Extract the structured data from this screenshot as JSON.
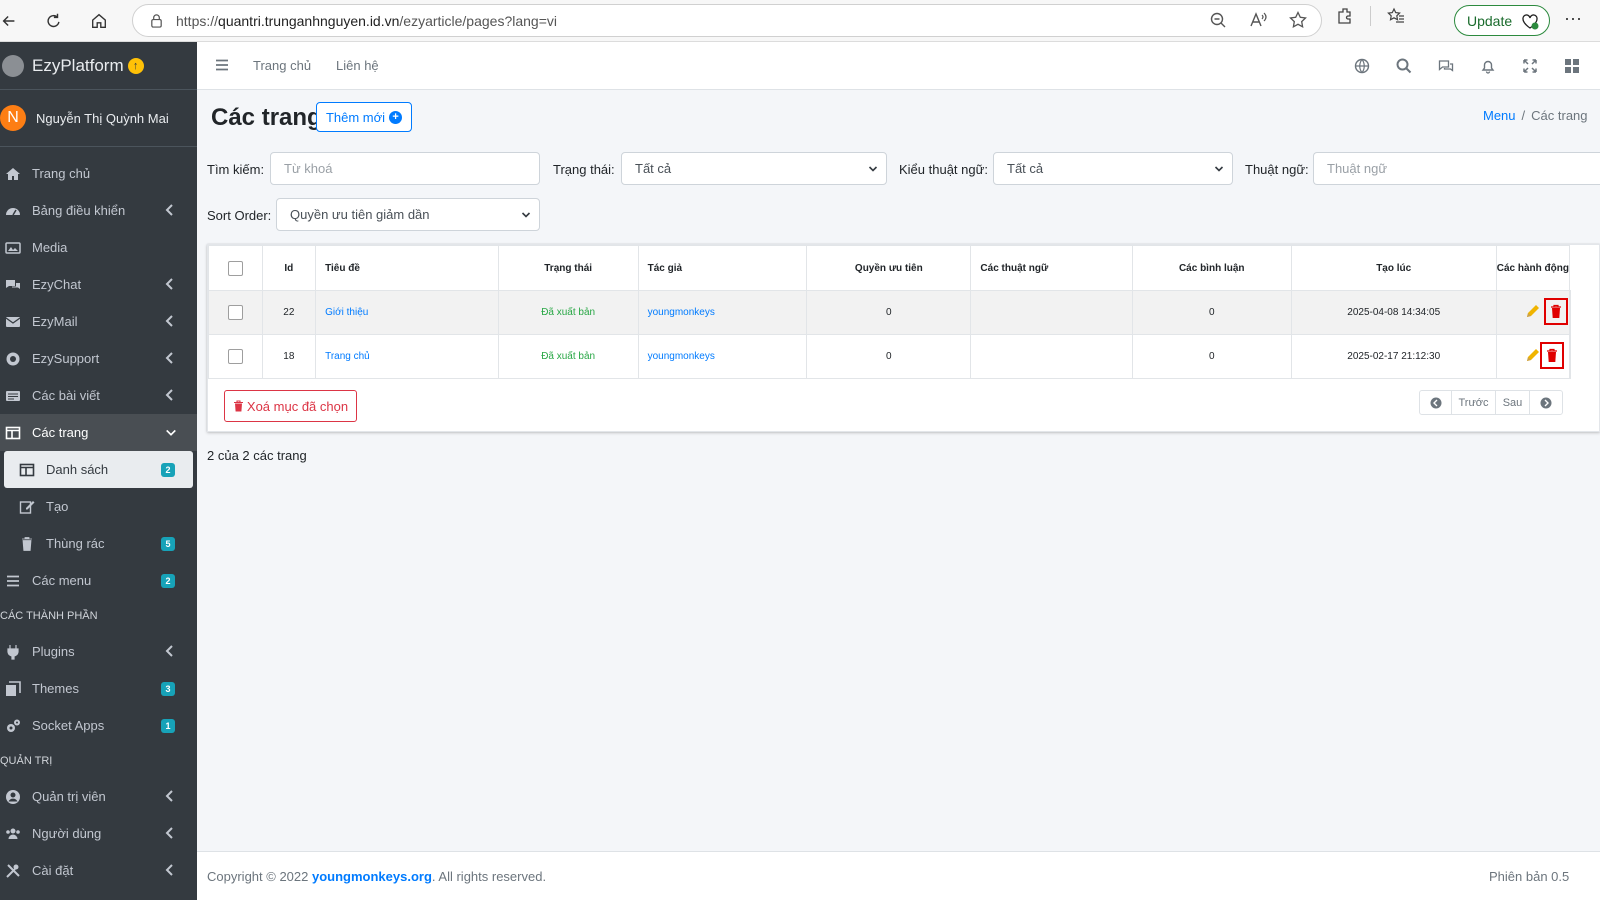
{
  "browser": {
    "url_prefix": "https://",
    "url_host": "quantri.trunganhnguyen.id.vn",
    "url_path": "/ezyarticle/pages?lang=vi",
    "update_label": "Update",
    "more_label": "···"
  },
  "sidebar": {
    "brand": "EzyPlatform",
    "user_initial": "N",
    "user_name": "Nguyễn Thị Quỳnh Mai",
    "items": [
      {
        "label": "Trang chủ"
      },
      {
        "label": "Bảng điều khiển"
      },
      {
        "label": "Media"
      },
      {
        "label": "EzyChat"
      },
      {
        "label": "EzyMail"
      },
      {
        "label": "EzySupport"
      },
      {
        "label": "Các bài viết"
      },
      {
        "label": "Các trang"
      },
      {
        "label": "Danh sách",
        "badge": "2"
      },
      {
        "label": "Tạo"
      },
      {
        "label": "Thùng rác",
        "badge": "5"
      },
      {
        "label": "Các menu",
        "badge": "2"
      },
      {
        "label": "Plugins"
      },
      {
        "label": "Themes",
        "badge": "3"
      },
      {
        "label": "Socket Apps",
        "badge": "1"
      },
      {
        "label": "Quản trị viên"
      },
      {
        "label": "Người dùng"
      },
      {
        "label": "Cài đặt"
      }
    ],
    "headers": [
      "CÁC THÀNH PHẦN",
      "QUẢN TRỊ"
    ]
  },
  "topnav": {
    "home": "Trang chủ",
    "contact": "Liên hệ"
  },
  "page": {
    "title": "Các trang",
    "add_button": "Thêm mới",
    "breadcrumb_menu": "Menu",
    "breadcrumb_sep": "/",
    "breadcrumb_current": "Các trang"
  },
  "filters": {
    "search_label": "Tìm kiếm:",
    "search_placeholder": "Từ khoá",
    "status_label": "Trạng thái:",
    "status_value": "Tất cả",
    "term_type_label": "Kiểu thuật ngữ:",
    "term_type_value": "Tất cả",
    "term_label": "Thuật ngữ:",
    "term_placeholder": "Thuật ngữ",
    "sort_label": "Sort Order:",
    "sort_value": "Quyền ưu tiên giảm dần"
  },
  "table": {
    "columns": [
      "Id",
      "Tiêu đề",
      "Trạng thái",
      "Tác giả",
      "Quyền ưu tiên",
      "Các thuật ngữ",
      "Các bình luận",
      "Tạo lúc",
      "Các hành động"
    ],
    "rows": [
      {
        "id": "22",
        "title": "Giới thiệu",
        "status": "Đã xuất bản",
        "author": "youngmonkeys",
        "priority": "0",
        "terms": "",
        "comments": "0",
        "created": "2025-04-08 14:34:05"
      },
      {
        "id": "18",
        "title": "Trang chủ",
        "status": "Đã xuất bản",
        "author": "youngmonkeys",
        "priority": "0",
        "terms": "",
        "comments": "0",
        "created": "2025-02-17 21:12:30"
      }
    ],
    "delete_selected": "Xoá mục đã chọn",
    "prev": "Trước",
    "next": "Sau",
    "count_text": "2 của 2 các trang"
  },
  "footer": {
    "copyright_prefix": "Copyright © 2022 ",
    "copyright_link": "youngmonkeys.org",
    "copyright_suffix": ". All rights reserved.",
    "version": "Phiên bản 0.5"
  },
  "colors": {
    "sidebar_bg": "#343a40",
    "primary": "#007bff",
    "danger": "#dc3545",
    "success": "#28a745",
    "badge": "#17a2b8"
  }
}
